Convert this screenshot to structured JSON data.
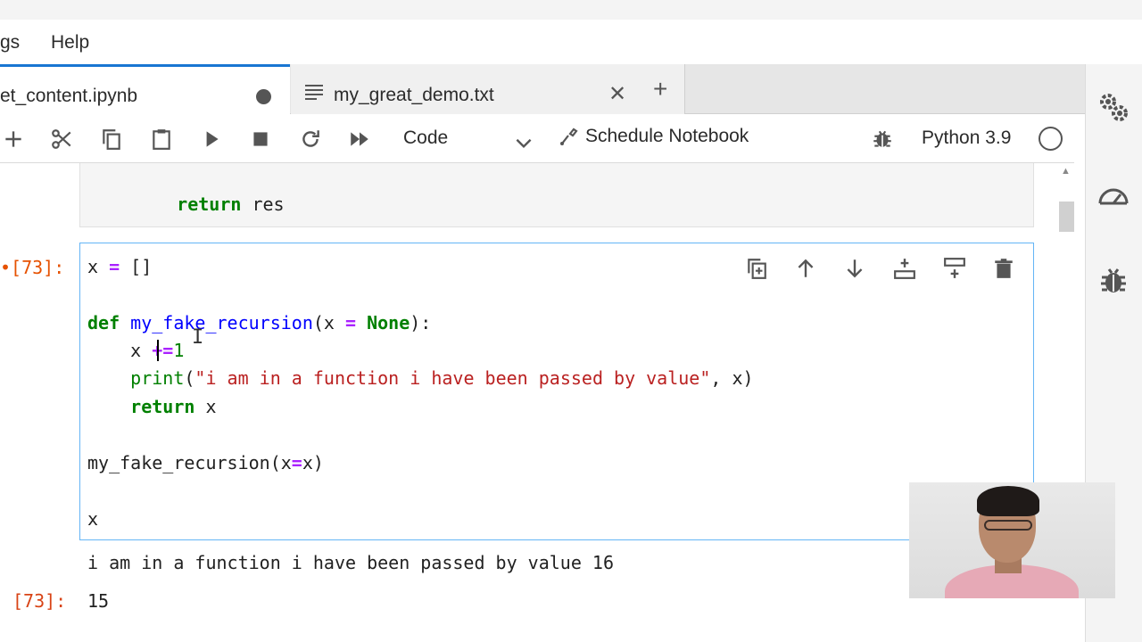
{
  "menubar": {
    "items": [
      "gs",
      "Help"
    ]
  },
  "tabs": [
    {
      "label": "et_content.ipynb",
      "active": true,
      "dirty": true
    },
    {
      "label": "my_great_demo.txt",
      "active": false,
      "close": "✕"
    }
  ],
  "new_tab_glyph": "+",
  "toolbar": {
    "cell_type": "Code",
    "schedule_label": "Schedule Notebook",
    "kernel": "Python 3.9",
    "icons": [
      "add-cell-icon",
      "cut-icon",
      "copy-icon",
      "paste-icon",
      "run-icon",
      "stop-icon",
      "restart-icon",
      "fast-forward-icon",
      "chevron-down-icon",
      "schedule-icon",
      "debug-icon",
      "kernel-idle-icon"
    ]
  },
  "prev_cell": {
    "line": "    return res"
  },
  "cell": {
    "prompt": "•[73]:",
    "lines": [
      {
        "t": "x = []"
      },
      {
        "t": ""
      },
      {
        "t": "def my_fake_recursion(x = None):"
      },
      {
        "t": "    x +=1"
      },
      {
        "t": "    print(\"i am in a function i have been passed by value\", x)"
      },
      {
        "t": "    return x"
      },
      {
        "t": ""
      },
      {
        "t": "my_fake_recursion(x=x)"
      },
      {
        "t": ""
      },
      {
        "t": "x"
      }
    ],
    "stdout": "i am in a function i have been passed by value 16",
    "out_prompt": "[73]:",
    "result": "15"
  },
  "cell_tools": [
    "duplicate-cell-icon",
    "move-up-icon",
    "move-down-icon",
    "insert-below-icon",
    "insert-above-icon",
    "delete-icon"
  ],
  "sidebar_icons": [
    "property-inspector-icon",
    "resource-usage-icon",
    "debugger-icon"
  ],
  "colors": {
    "accent": "#1976d2",
    "cell_border": "#64b5f6",
    "prompt": "#e65100",
    "keyword": "#008000",
    "string": "#ba2121",
    "operator": "#aa22ff"
  }
}
